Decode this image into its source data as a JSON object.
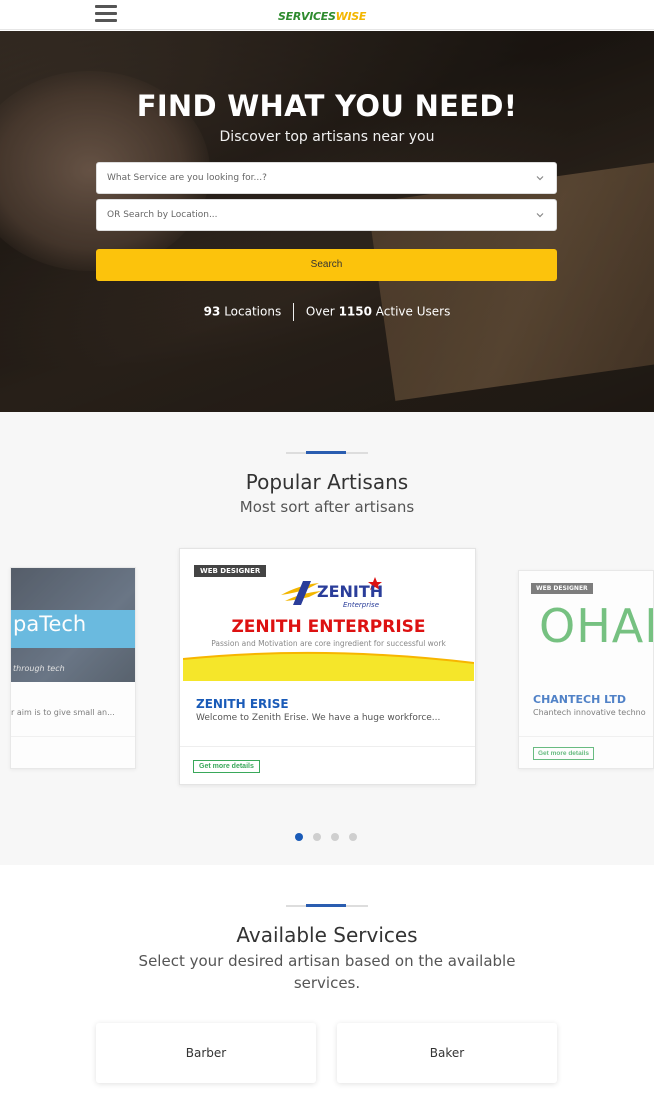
{
  "header": {
    "logo_part1": "SERVICES",
    "logo_part2": "WISE",
    "menu_icon": "hamburger-icon"
  },
  "hero": {
    "title": "FIND WHAT YOU NEED!",
    "subtitle": "Discover top artisans near you",
    "service_select": {
      "placeholder": "What Service are you looking for...?"
    },
    "location_select": {
      "placeholder": "OR Search by Location..."
    },
    "search_label": "Search",
    "stats": {
      "locations_count": "93",
      "locations_label": "Locations",
      "users_prefix": "Over",
      "users_count": "1150",
      "users_label": "Active Users"
    }
  },
  "artisans": {
    "title": "Popular Artisans",
    "subtitle": "Most sort after artisans",
    "cards": [
      {
        "logo_text": "paTech",
        "logo_tagline": "through tech",
        "description": "r aim is to give small an..."
      },
      {
        "tag": "WEB DESIGNER",
        "logo_word": "ZENITH",
        "logo_sub": "Enterprise",
        "banner_title": "ZENITH ENTERPRISE",
        "banner_tagline": "Passion and Motivation are core ingredient for successful work",
        "name": "ZENITH ERISE",
        "description": "Welcome to Zenith Erise. We have a huge workforce...",
        "button_label": "Get more details"
      },
      {
        "tag": "WEB DESIGNER",
        "logo_text": "OHAN",
        "name": "CHANTECH LTD",
        "description": "Chantech innovative techno",
        "button_label": "Get more details"
      }
    ],
    "dots": [
      true,
      false,
      false,
      false
    ],
    "colors": {
      "accent": "#1a5bb8",
      "cta_green": "#39a85a"
    }
  },
  "services": {
    "title": "Available Services",
    "subtitle": "Select your desired artisan based on the available services.",
    "items": [
      "Barber",
      "Baker"
    ]
  },
  "theme": {
    "primary_yellow": "#fcc30c",
    "divider_blue": "#2a5db0"
  }
}
